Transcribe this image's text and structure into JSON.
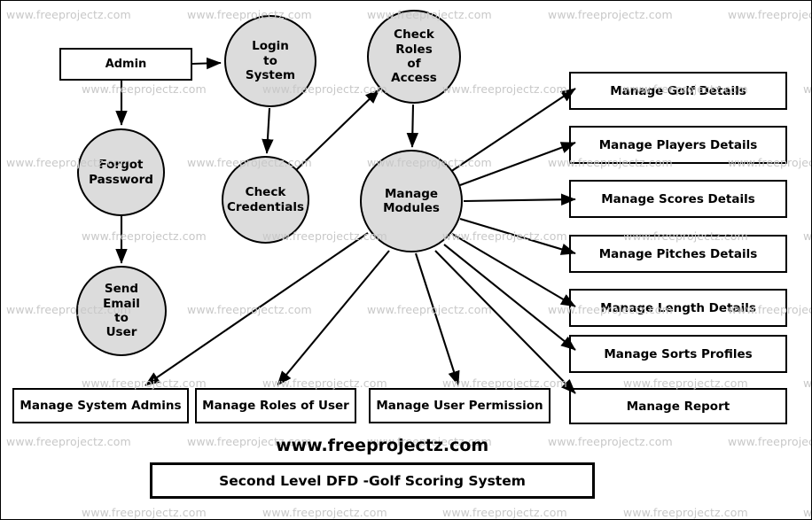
{
  "diagram": {
    "title": "Second Level DFD -Golf Scoring System",
    "site_label": "www.freeprojectz.com",
    "watermark_text": "www.freeprojectz.com",
    "colors": {
      "process_fill": "#dcdcdc",
      "stroke": "#000000",
      "watermark": "#c8c8c8",
      "background": "#ffffff"
    },
    "external_entity": {
      "label": "Admin"
    },
    "processes": [
      {
        "id": "login",
        "label": "Login to System",
        "lines": [
          "Login",
          "to",
          "System"
        ]
      },
      {
        "id": "check_roles",
        "label": "Check Roles of Access",
        "lines": [
          "Check",
          "Roles",
          "of",
          "Access"
        ]
      },
      {
        "id": "forgot_password",
        "label": "Forgot Password",
        "lines": [
          "Forgot",
          "Password"
        ]
      },
      {
        "id": "check_credentials",
        "label": "Check Credentials",
        "lines": [
          "Check",
          "Credentials"
        ]
      },
      {
        "id": "manage_modules",
        "label": "Manage Modules",
        "lines": [
          "Manage",
          "Modules"
        ]
      },
      {
        "id": "send_email",
        "label": "Send Email to User",
        "lines": [
          "Send",
          "Email",
          "to",
          "User"
        ]
      }
    ],
    "right_boxes": [
      {
        "label": "Manage Golf Details"
      },
      {
        "label": "Manage Players Details"
      },
      {
        "label": "Manage Scores Details"
      },
      {
        "label": "Manage Pitches Details"
      },
      {
        "label": "Manage Length Details"
      },
      {
        "label": "Manage Sorts Profiles"
      },
      {
        "label": "Manage  Report"
      }
    ],
    "bottom_boxes": [
      {
        "label": "Manage System Admins"
      },
      {
        "label": "Manage Roles of User"
      },
      {
        "label": "Manage User Permission"
      }
    ]
  }
}
